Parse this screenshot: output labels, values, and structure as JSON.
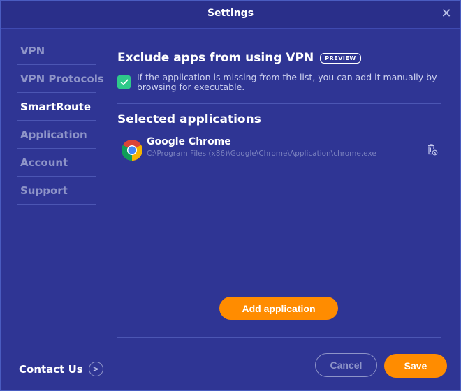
{
  "window": {
    "title": "Settings",
    "close_icon": "close-icon"
  },
  "sidebar": {
    "items": [
      {
        "label": "VPN",
        "active": false
      },
      {
        "label": "VPN Protocols",
        "active": false
      },
      {
        "label": "SmartRoute",
        "active": true
      },
      {
        "label": "Application",
        "active": false
      },
      {
        "label": "Account",
        "active": false
      },
      {
        "label": "Support",
        "active": false
      }
    ],
    "contact_label": "Contact Us",
    "contact_icon": "chevron-right-icon"
  },
  "main": {
    "heading": "Exclude apps from using VPN",
    "badge": "PREVIEW",
    "checkbox_checked": true,
    "checkbox_text": "If the application is missing from the list, you can add it manually by browsing for executable.",
    "selected_heading": "Selected applications",
    "apps": [
      {
        "name": "Google Chrome",
        "path": "C:\\Program Files (x86)\\Google\\Chrome\\Application\\chrome.exe",
        "icon": "chrome-icon",
        "action_icon": "trash-icon"
      }
    ],
    "add_button": "Add application"
  },
  "footer": {
    "cancel_label": "Cancel",
    "save_label": "Save"
  },
  "colors": {
    "background": "#2f3594",
    "accent": "#ff8c00",
    "checkbox": "#2ec98a",
    "muted_text": "#8e94c8"
  }
}
